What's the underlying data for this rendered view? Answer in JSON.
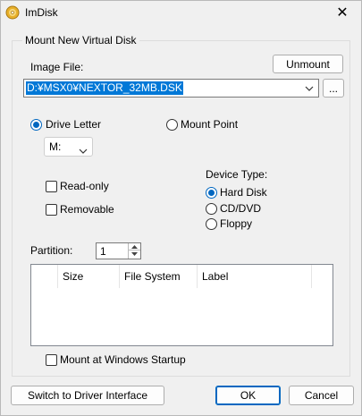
{
  "window": {
    "title": "ImDisk",
    "close_glyph": "✕"
  },
  "group": {
    "title": "Mount New Virtual Disk"
  },
  "image_file": {
    "label": "Image File:",
    "value": "D:¥MSX0¥NEXTOR_32MB.DSK",
    "browse_label": "...",
    "unmount_label": "Unmount"
  },
  "mount_target": {
    "drive_letter_label": "Drive Letter",
    "drive_letter_selected": true,
    "drive_letter_value": "M:",
    "mount_point_label": "Mount Point",
    "mount_point_selected": false
  },
  "options": {
    "read_only_label": "Read-only",
    "read_only_checked": false,
    "removable_label": "Removable",
    "removable_checked": false
  },
  "device_type": {
    "label": "Device Type:",
    "options": [
      "Hard Disk",
      "CD/DVD",
      "Floppy"
    ],
    "selected": "Hard Disk"
  },
  "partition": {
    "label": "Partition:",
    "value": "1"
  },
  "partition_list": {
    "columns": [
      "",
      "Size",
      "File System",
      "Label"
    ],
    "rows": []
  },
  "startup": {
    "label": "Mount at Windows Startup",
    "checked": false
  },
  "footer": {
    "driver_interface_label": "Switch to Driver Interface",
    "ok_label": "OK",
    "cancel_label": "Cancel"
  },
  "colors": {
    "accent": "#0067c0",
    "selection": "#0078d7",
    "window_bg": "#f0f0f0"
  },
  "icons": {
    "app": "disk-app-icon",
    "close": "close-icon",
    "dropdown": "chevron-down-icon",
    "spin_up": "spin-up-icon",
    "spin_down": "spin-down-icon"
  }
}
